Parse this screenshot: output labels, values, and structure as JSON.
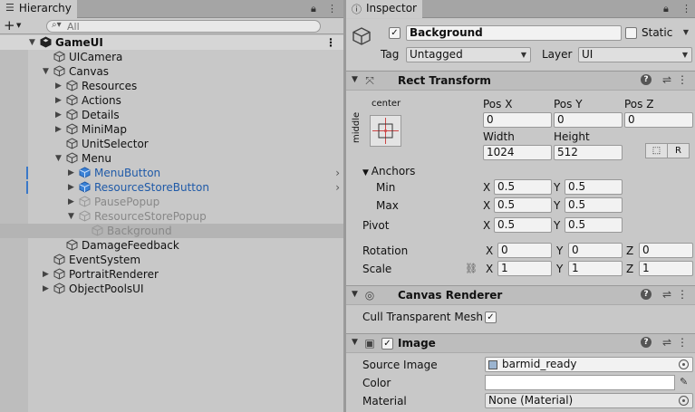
{
  "hierarchy": {
    "tab_title": "Hierarchy",
    "search_placeholder": "All",
    "scene_name": "GameUI",
    "items": [
      {
        "label": "UICamera"
      },
      {
        "label": "Canvas"
      },
      {
        "label": "Resources"
      },
      {
        "label": "Actions"
      },
      {
        "label": "Details"
      },
      {
        "label": "MiniMap"
      },
      {
        "label": "UnitSelector"
      },
      {
        "label": "Menu"
      },
      {
        "label": "MenuButton"
      },
      {
        "label": "ResourceStoreButton"
      },
      {
        "label": "PausePopup"
      },
      {
        "label": "ResourceStorePopup"
      },
      {
        "label": "Background"
      },
      {
        "label": "DamageFeedback"
      },
      {
        "label": "EventSystem"
      },
      {
        "label": "PortraitRenderer"
      },
      {
        "label": "ObjectPoolsUI"
      }
    ]
  },
  "inspector": {
    "tab_title": "Inspector",
    "object_name": "Background",
    "static_label": "Static",
    "tag_label": "Tag",
    "tag_value": "Untagged",
    "layer_label": "Layer",
    "layer_value": "UI",
    "rect_transform": {
      "title": "Rect Transform",
      "anchor_h": "center",
      "anchor_v": "middle",
      "pos_x_label": "Pos X",
      "pos_y_label": "Pos Y",
      "pos_z_label": "Pos Z",
      "pos_x": "0",
      "pos_y": "0",
      "pos_z": "0",
      "width_label": "Width",
      "height_label": "Height",
      "width": "1024",
      "height": "512",
      "anchors_label": "Anchors",
      "min_label": "Min",
      "max_label": "Max",
      "min_x": "0.5",
      "min_y": "0.5",
      "max_x": "0.5",
      "max_y": "0.5",
      "pivot_label": "Pivot",
      "pivot_x": "0.5",
      "pivot_y": "0.5",
      "rotation_label": "Rotation",
      "rot_x": "0",
      "rot_y": "0",
      "rot_z": "0",
      "scale_label": "Scale",
      "scale_x": "1",
      "scale_y": "1",
      "scale_z": "1",
      "x": "X",
      "y": "Y",
      "z": "Z",
      "raw_button": "R"
    },
    "canvas_renderer": {
      "title": "Canvas Renderer",
      "cull_label": "Cull Transparent Mesh"
    },
    "image": {
      "title": "Image",
      "source_label": "Source Image",
      "source_value": "barmid_ready",
      "color_label": "Color",
      "material_label": "Material",
      "material_value": "None (Material)"
    }
  }
}
